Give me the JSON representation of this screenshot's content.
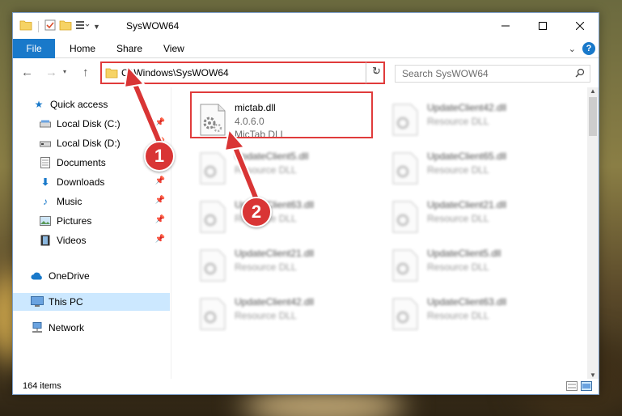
{
  "window": {
    "title": "SysWOW64"
  },
  "ribbon": {
    "tabs": [
      {
        "label": "File"
      },
      {
        "label": "Home"
      },
      {
        "label": "Share"
      },
      {
        "label": "View"
      }
    ]
  },
  "navigation": {
    "address": "C:\\Windows\\SysWOW64",
    "search_placeholder": "Search SysWOW64"
  },
  "sidebar": {
    "items": [
      {
        "label": "Quick access",
        "icon": "star-icon"
      },
      {
        "label": "Local Disk (C:)",
        "icon": "drive-icon",
        "pinned": true
      },
      {
        "label": "Local Disk (D:)",
        "icon": "drive-icon",
        "pinned": true
      },
      {
        "label": "Documents",
        "icon": "documents-icon",
        "pinned": true
      },
      {
        "label": "Downloads",
        "icon": "download-icon",
        "pinned": true
      },
      {
        "label": "Music",
        "icon": "music-icon",
        "pinned": true
      },
      {
        "label": "Pictures",
        "icon": "pictures-icon",
        "pinned": true
      },
      {
        "label": "Videos",
        "icon": "videos-icon",
        "pinned": true
      },
      {
        "label": "OneDrive",
        "icon": "cloud-icon"
      },
      {
        "label": "This PC",
        "icon": "computer-icon",
        "selected": true
      },
      {
        "label": "Network",
        "icon": "network-icon"
      }
    ]
  },
  "files": [
    {
      "name": "mictab.dll",
      "line1": "4.0.6.0",
      "line2": "MicTab DLL",
      "highlight": true
    },
    {
      "name": "UpdateClient42.dll",
      "line1": "Resource DLL",
      "line2": ""
    },
    {
      "name": "UpdateClient5.dll",
      "line1": "Resource DLL",
      "line2": ""
    },
    {
      "name": "UpdateClient65.dll",
      "line1": "Resource DLL",
      "line2": ""
    },
    {
      "name": "UpdateClient63.dll",
      "line1": "Resource DLL",
      "line2": ""
    },
    {
      "name": "UpdateClient21.dll",
      "line1": "Resource DLL",
      "line2": ""
    },
    {
      "name": "UpdateClient21.dll",
      "line1": "Resource DLL",
      "line2": ""
    },
    {
      "name": "UpdateClient5.dll",
      "line1": "Resource DLL",
      "line2": ""
    },
    {
      "name": "UpdateClient42.dll",
      "line1": "Resource DLL",
      "line2": ""
    },
    {
      "name": "UpdateClient63.dll",
      "line1": "Resource DLL",
      "line2": ""
    }
  ],
  "status": {
    "item_count": "164 items"
  },
  "callouts": [
    {
      "label": "1"
    },
    {
      "label": "2"
    }
  ],
  "colors": {
    "accent": "#1979ca",
    "highlight_red": "#e03b3b",
    "selected_bg": "#cce8ff"
  }
}
